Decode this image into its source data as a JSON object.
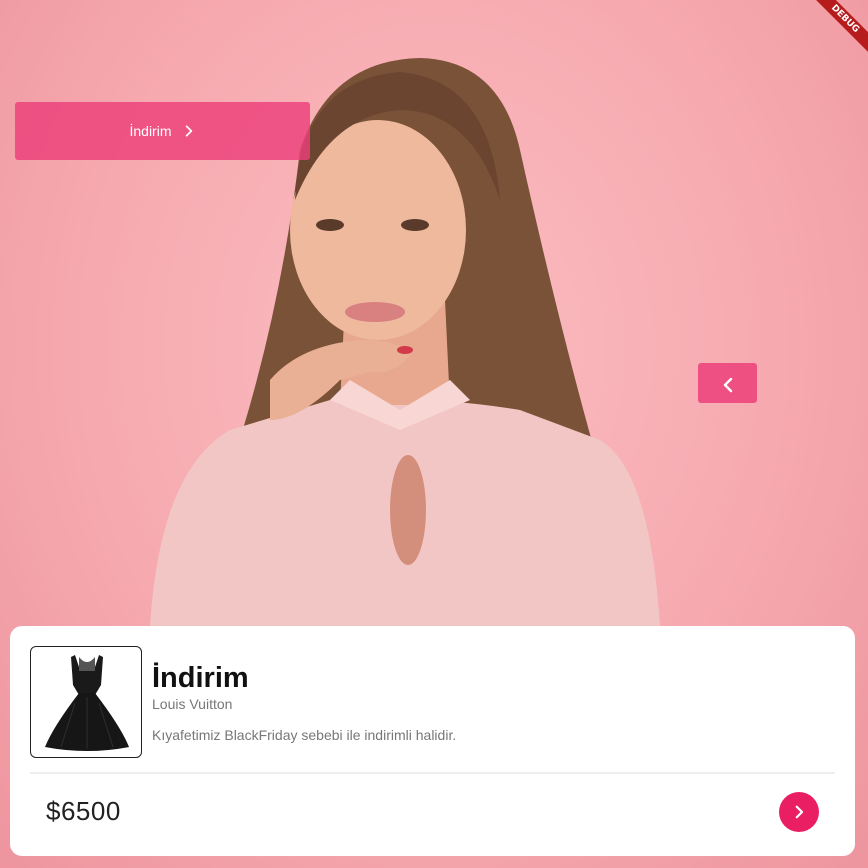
{
  "debug_banner": "DEBUG",
  "promo": {
    "label": "İndirim",
    "icon": "chevron-right-icon",
    "color": "#ec407a"
  },
  "carousel": {
    "prev_icon": "chevron-left-icon"
  },
  "product": {
    "title": "İndirim",
    "brand": "Louis Vuitton",
    "description": "Kıyafetimiz BlackFriday sebebi ile indirimli halidir.",
    "price": "$6500",
    "action_icon": "chevron-right-icon",
    "accent_color": "#e91e63"
  }
}
